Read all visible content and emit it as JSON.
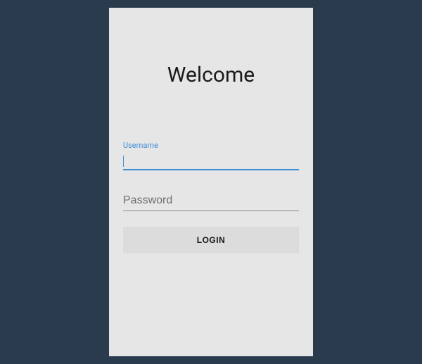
{
  "title": "Welcome",
  "form": {
    "username": {
      "label": "Username",
      "value": ""
    },
    "password": {
      "placeholder": "Password",
      "value": ""
    },
    "login_label": "LOGIN"
  }
}
